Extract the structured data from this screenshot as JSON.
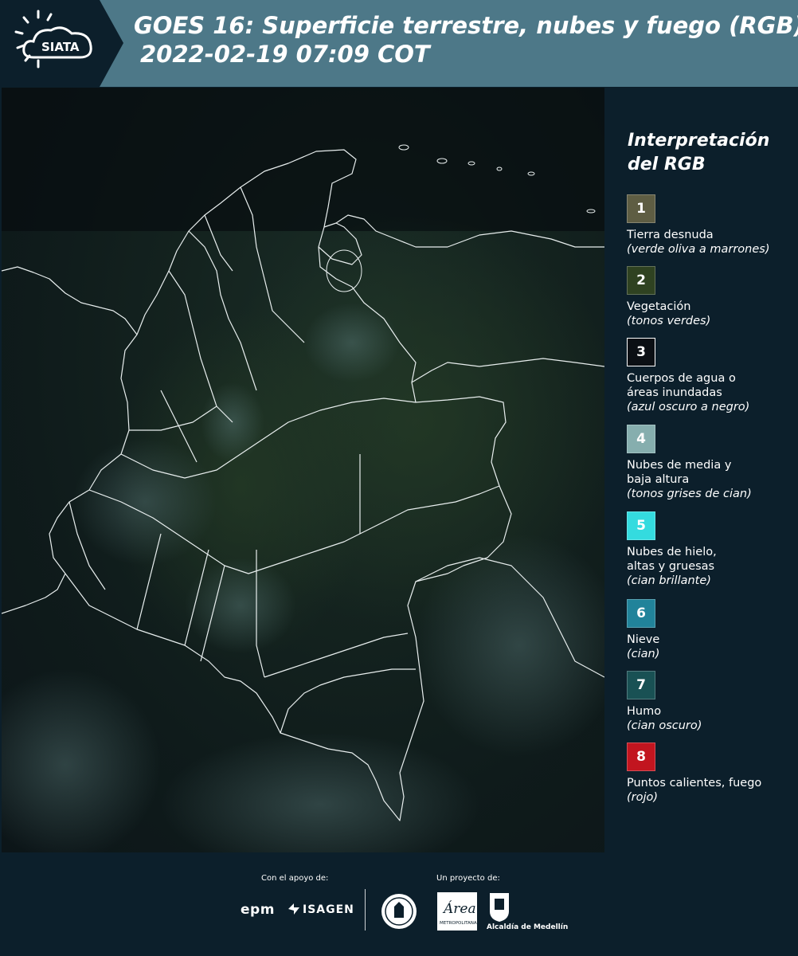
{
  "header": {
    "logo_text": "SIATA",
    "title_line1": "GOES 16: Superficie terrestre, nubes y fuego (RGB)",
    "title_line2": "2022-02-19 07:09 COT",
    "background_color": "#4d7888",
    "logo_panel_color": "#0c1f2b"
  },
  "legend": {
    "title": "Interpretación del RGB",
    "items": [
      {
        "number": "1",
        "label": "Tierra desnuda",
        "sub": "(verde oliva a marrones)",
        "color": "#5e5d43"
      },
      {
        "number": "2",
        "label": "Vegetación",
        "sub": "(tonos verdes)",
        "color": "#2f4221"
      },
      {
        "number": "3",
        "label": "Cuerpos de agua o áreas inundadas",
        "sub": "(azul oscuro a negro)",
        "color": "#0b0f14"
      },
      {
        "number": "4",
        "label": "Nubes de media y baja altura",
        "sub": "(tonos grises de cian)",
        "color": "#86aeae"
      },
      {
        "number": "5",
        "label": "Nubes de hielo, altas y gruesas",
        "sub": "(cian brillante)",
        "color": "#34dbdf"
      },
      {
        "number": "6",
        "label": "Nieve",
        "sub": "(cian)",
        "color": "#21839a"
      },
      {
        "number": "7",
        "label": "Humo",
        "sub": "(cian oscuro)",
        "color": "#195154"
      },
      {
        "number": "8",
        "label": "Puntos calientes, fuego",
        "sub": "(rojo)",
        "color": "#c2151f"
      }
    ]
  },
  "footer": {
    "support_label": "Con el apoyo de:",
    "project_label": "Un proyecto de:",
    "sponsor_1": "epm",
    "sponsor_2": "ISAGEN",
    "area_logo_text": "Área",
    "area_logo_sub": "METROPOLITANA",
    "alcaldia_label": "Alcaldía de Medellín"
  }
}
